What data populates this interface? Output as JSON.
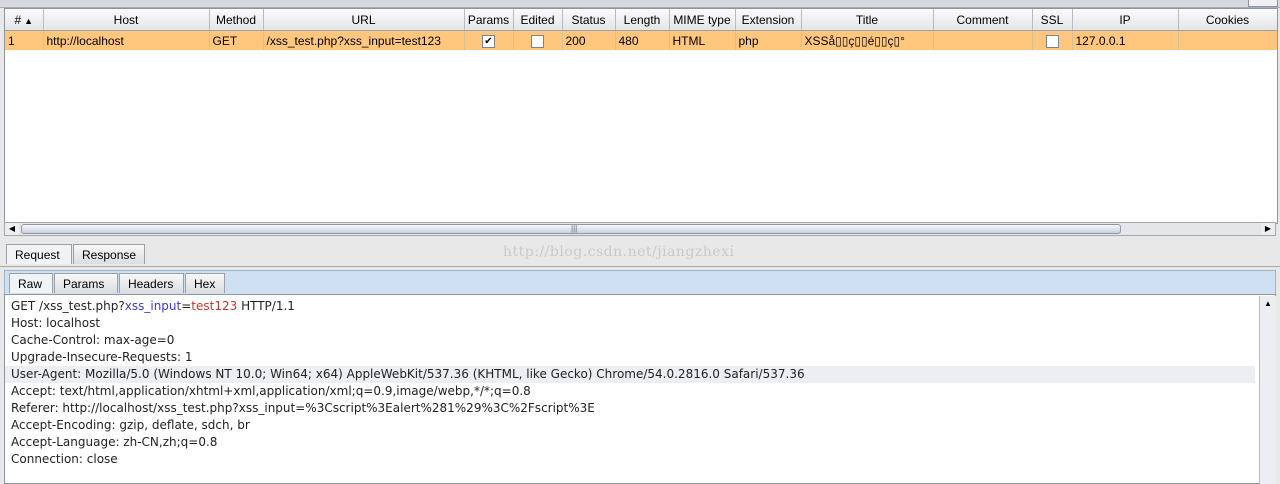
{
  "history_table": {
    "columns": [
      {
        "label": "#",
        "sorted": true
      },
      {
        "label": "Host"
      },
      {
        "label": "Method"
      },
      {
        "label": "URL"
      },
      {
        "label": "Params"
      },
      {
        "label": "Edited"
      },
      {
        "label": "Status"
      },
      {
        "label": "Length"
      },
      {
        "label": "MIME type"
      },
      {
        "label": "Extension"
      },
      {
        "label": "Title"
      },
      {
        "label": "Comment"
      },
      {
        "label": "SSL"
      },
      {
        "label": "IP"
      },
      {
        "label": "Cookies"
      }
    ],
    "rows": [
      {
        "num": "1",
        "host": "http://localhost",
        "method": "GET",
        "url": "/xss_test.php?xss_input=test123",
        "params": true,
        "edited": false,
        "status": "200",
        "length": "480",
        "mime": "HTML",
        "extension": "php",
        "title": "XSSå▯▯ç▯▯é▯▯ç▯°",
        "comment": "",
        "ssl": false,
        "ip": "127.0.0.1",
        "cookies": ""
      }
    ],
    "selected_row_color": "#ffc77e",
    "sort_arrow": "▲"
  },
  "tabs": {
    "request": "Request",
    "response": "Response"
  },
  "subtabs": {
    "raw": "Raw",
    "params": "Params",
    "headers": "Headers",
    "hex": "Hex"
  },
  "watermark": "http://blog.csdn.net/jiangzhexi",
  "request_raw": {
    "line1": {
      "prefix": "GET /xss_test.php?",
      "param_name": "xss_input",
      "eq": "=",
      "param_value": "test123",
      "suffix": " HTTP/1.1"
    },
    "lines": [
      "Host: localhost",
      "Cache-Control: max-age=0",
      "Upgrade-Insecure-Requests: 1",
      "User-Agent: Mozilla/5.0 (Windows NT 10.0; Win64; x64) AppleWebKit/537.36 (KHTML, like Gecko) Chrome/54.0.2816.0 Safari/537.36",
      "Accept: text/html,application/xhtml+xml,application/xml;q=0.9,image/webp,*/*;q=0.8",
      "Referer: http://localhost/xss_test.php?xss_input=%3Cscript%3Ealert%281%29%3C%2Fscript%3E",
      "Accept-Encoding: gzip, deflate, sdch, br",
      "Accept-Language: zh-CN,zh;q=0.8",
      "Connection: close"
    ],
    "param_name_color": "#3b3bd0",
    "param_value_color": "#c0392b"
  },
  "scroll_icons": {
    "left": "scroll-left-arrow-icon",
    "right": "scroll-right-arrow-icon",
    "up": "scroll-up-arrow-icon"
  }
}
